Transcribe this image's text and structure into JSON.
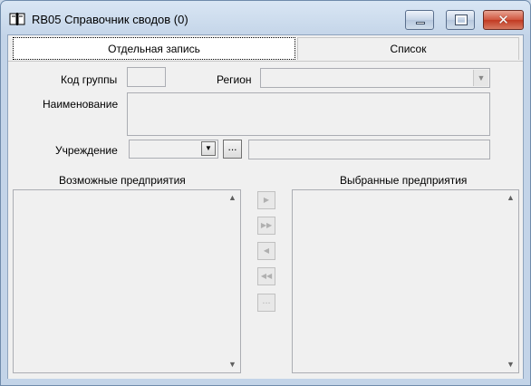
{
  "window": {
    "title": "RB05 Справочник сводов (0)",
    "close_glyph": "✕"
  },
  "tabs": [
    {
      "label": "Отдельная запись",
      "active": true
    },
    {
      "label": "Список",
      "active": false
    }
  ],
  "form": {
    "group_code_label": "Код группы",
    "group_code_value": "",
    "region_label": "Регион",
    "region_value": "",
    "name_label": "Наименование",
    "name_value": "",
    "institution_label": "Учреждение",
    "institution_value": "",
    "institution_name_value": "",
    "browse_label": "..."
  },
  "lists": {
    "available_label": "Возможные предприятия",
    "selected_label": "Выбранные предприятия",
    "available_items": [],
    "selected_items": []
  },
  "transfer": {
    "move_one": "▶",
    "move_all": "▶▶",
    "remove_one": "◀",
    "remove_all": "◀◀",
    "more": "..."
  },
  "icons": {
    "app": "book-icon",
    "dropdown": "▼",
    "scroll_up": "▲",
    "scroll_down": "▼"
  },
  "colors": {
    "title_bar": "#c9d8ea",
    "close_button": "#c94a33",
    "panel": "#f0f0f0"
  }
}
